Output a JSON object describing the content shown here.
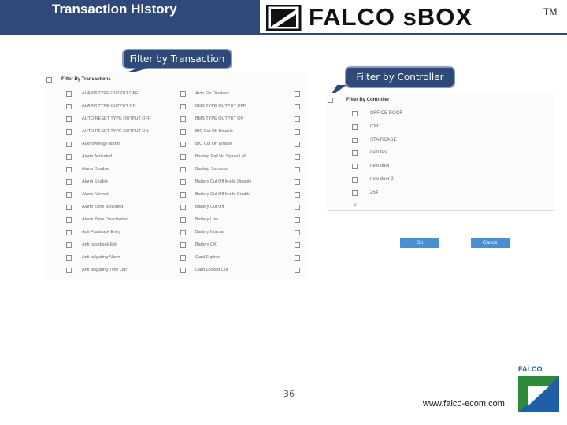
{
  "header": {
    "title": "Transaction History",
    "brand_name": "FALCO sBOX",
    "trademark": "TM"
  },
  "callouts": {
    "transaction": "Filter by Transaction",
    "controller": "Filter by Controller"
  },
  "transaction_panel": {
    "header_label": "Filter By Transactions",
    "rows": [
      {
        "left": "ALARM TYPE OUTPUT OFF",
        "right": "Auto Fin Disables"
      },
      {
        "left": "ALARM TYPE OUTPUT ON",
        "right": "BMS TYPE OUTPUT OFF"
      },
      {
        "left": "AUTO RESET TYPE OUTPUT OFF",
        "right": "BMS TYPE OUTPUT ON"
      },
      {
        "left": "AUTO RESET TYPE OUTPUT ON",
        "right": "BIC Cut Off Disable"
      },
      {
        "left": "Acknowledge alarm",
        "right": "BIC Cut Off Enable"
      },
      {
        "left": "Alarm Activated",
        "right": "Backup Fail No Space Left"
      },
      {
        "left": "Alarm Disable",
        "right": "Backup Success"
      },
      {
        "left": "Alarm Enable",
        "right": "Battery Cut Off Mode Disable"
      },
      {
        "left": "Alarm Normal",
        "right": "Battery Cut Off Mode Enable"
      },
      {
        "left": "Alarm Zone Activated",
        "right": "Battery Cut Off"
      },
      {
        "left": "Alarm Zone Deactivated",
        "right": "Battery Low"
      },
      {
        "left": "Anti Passback Entry",
        "right": "Battery Normal"
      },
      {
        "left": "Anti passback Exit",
        "right": "Battery OK"
      },
      {
        "left": "Anti tailgating Alarm",
        "right": "Card Expired"
      },
      {
        "left": "Anti tailgating Time Out",
        "right": "Card Locked Out"
      }
    ]
  },
  "controller_panel": {
    "header_label": "Filter By Controller",
    "items": [
      "OFFICE DOOR",
      "CNO",
      "STAIRCASE",
      "cam test",
      "new door",
      "new door 2",
      "254"
    ],
    "scroll_left_symbol": "<",
    "go_label": "Go",
    "cancel_label": "Cancel"
  },
  "footer": {
    "page_number": "36",
    "website": "www.falco-ecom.com",
    "corner_logo_text": "FALCO"
  },
  "colors": {
    "header_bg": "#2f4a78",
    "button_blue": "#4a8fd6",
    "logo_blue": "#1f5fa8",
    "logo_green": "#2e8b3a"
  },
  "icons": {
    "brand_logo": "falco-logo-icon",
    "checkbox": "checkbox-icon",
    "scroll_left": "chevron-left-icon"
  }
}
